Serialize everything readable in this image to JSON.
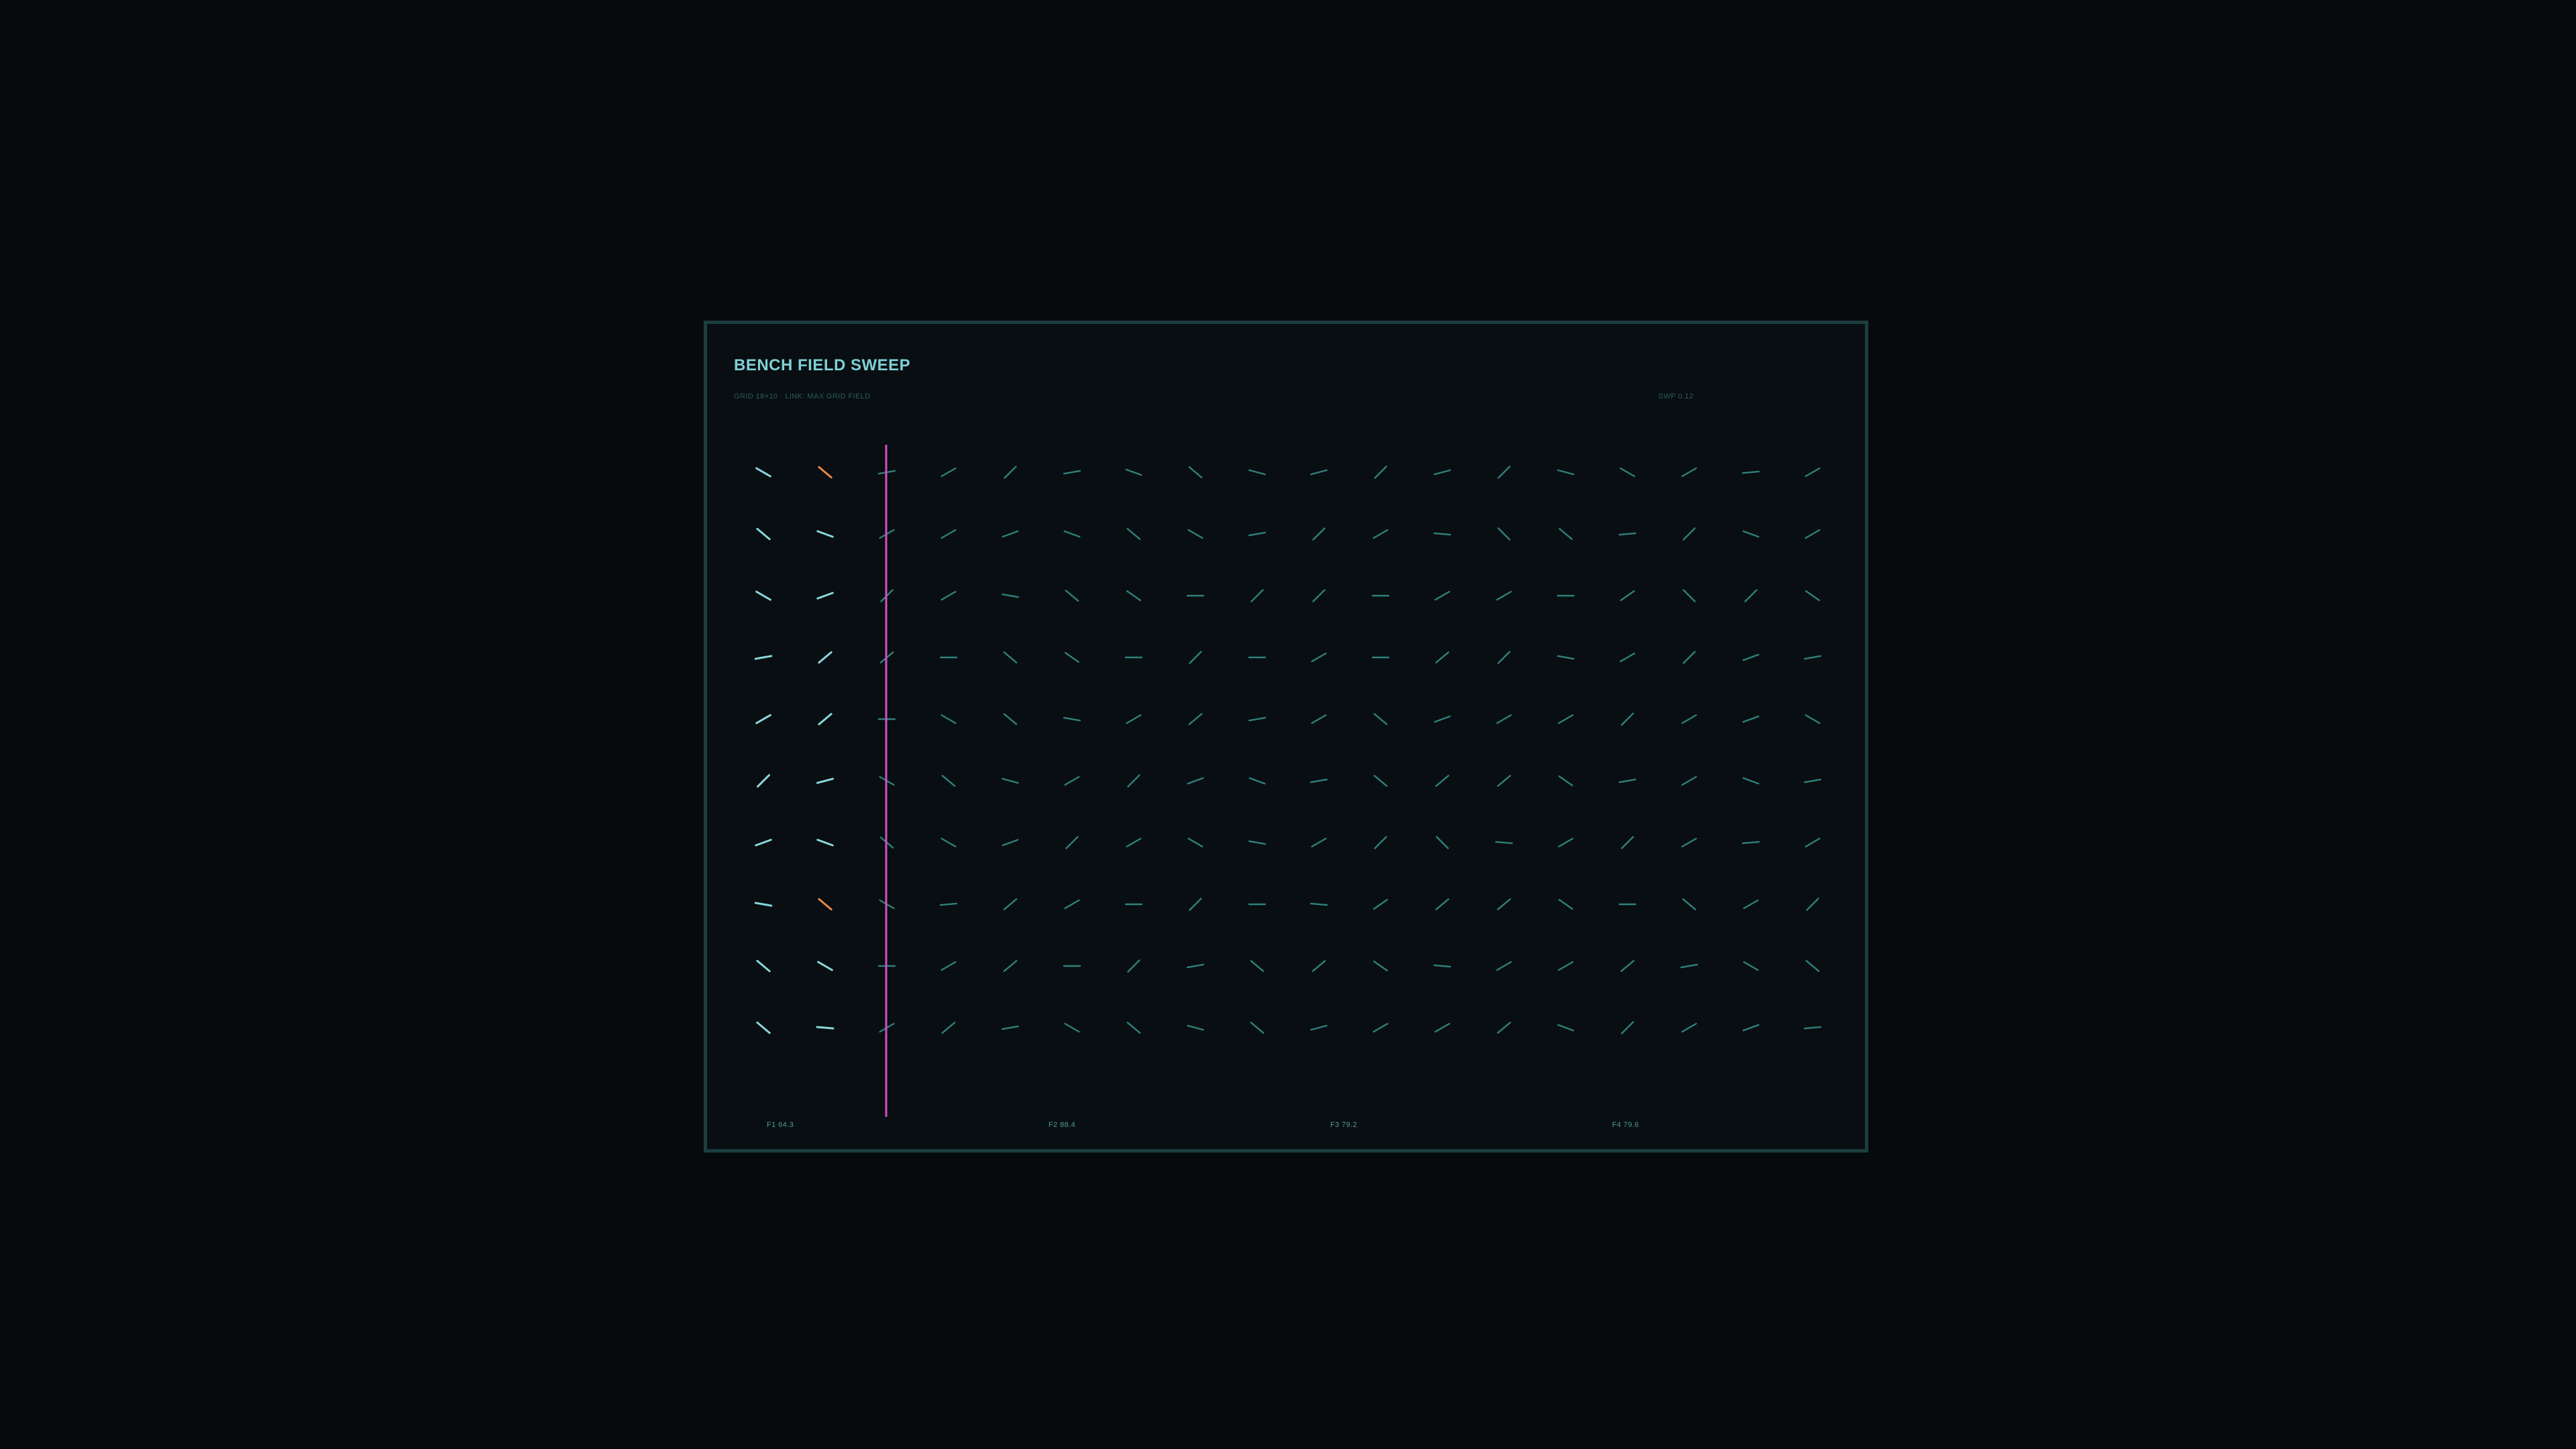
{
  "title": "BENCH FIELD SWEEP",
  "meta_left": "GRID 18×10 · LINK: MAX GRID FIELD",
  "meta_right": "SWP 0.12",
  "footer_labels": [
    "F1 64.3",
    "F2 88.4",
    "F3 79.2",
    "F4 79.6"
  ],
  "colors": {
    "background": "#060a0d",
    "panel": "#080e11",
    "border": "#1d3e40",
    "title": "#7fd0d5",
    "bright_tick": "#8ad7dc",
    "dim_tick": "#2f807d",
    "highlight": "#e8874a",
    "cursor": "#d34fc4"
  },
  "field": {
    "columns": 18,
    "rows": 10,
    "sweep_column": 3,
    "highlights": [
      [
        0,
        1
      ],
      [
        7,
        1
      ]
    ],
    "angles_deg": [
      [
        30,
        40,
        -10,
        -30,
        -45,
        -10,
        20,
        40,
        15,
        -15,
        -45,
        -15,
        -45,
        15,
        30,
        -30,
        -5,
        -30
      ],
      [
        40,
        20,
        -30,
        -30,
        -20,
        20,
        40,
        30,
        -10,
        -45,
        -30,
        5,
        45,
        40,
        -5,
        -45,
        20,
        -30
      ],
      [
        30,
        -20,
        -45,
        -30,
        10,
        40,
        35,
        0,
        -45,
        -45,
        0,
        -30,
        -30,
        0,
        -35,
        45,
        -45,
        35
      ],
      [
        -10,
        -40,
        -40,
        0,
        40,
        35,
        0,
        -45,
        0,
        -30,
        0,
        -40,
        -45,
        10,
        -30,
        -45,
        -20,
        -10
      ],
      [
        -30,
        -40,
        0,
        30,
        40,
        10,
        -30,
        -40,
        -10,
        -30,
        40,
        -20,
        -30,
        -30,
        -45,
        -30,
        -20,
        30
      ],
      [
        -45,
        -15,
        30,
        40,
        15,
        -30,
        -45,
        -20,
        20,
        -10,
        40,
        -40,
        -40,
        35,
        -10,
        -30,
        20,
        -10
      ],
      [
        -20,
        20,
        40,
        30,
        -20,
        -45,
        -30,
        30,
        10,
        -30,
        -45,
        45,
        5,
        -30,
        -45,
        -30,
        -5,
        -30
      ],
      [
        10,
        40,
        30,
        -5,
        -40,
        -30,
        0,
        -45,
        0,
        5,
        -35,
        -40,
        -40,
        35,
        0,
        40,
        -30,
        -45
      ],
      [
        40,
        30,
        0,
        -30,
        -40,
        0,
        -45,
        -10,
        40,
        -40,
        35,
        5,
        -30,
        -30,
        -40,
        -10,
        30,
        40
      ],
      [
        40,
        5,
        -30,
        -40,
        -10,
        30,
        40,
        15,
        40,
        -15,
        -30,
        -30,
        -40,
        20,
        -45,
        -30,
        -20,
        -5
      ]
    ]
  }
}
